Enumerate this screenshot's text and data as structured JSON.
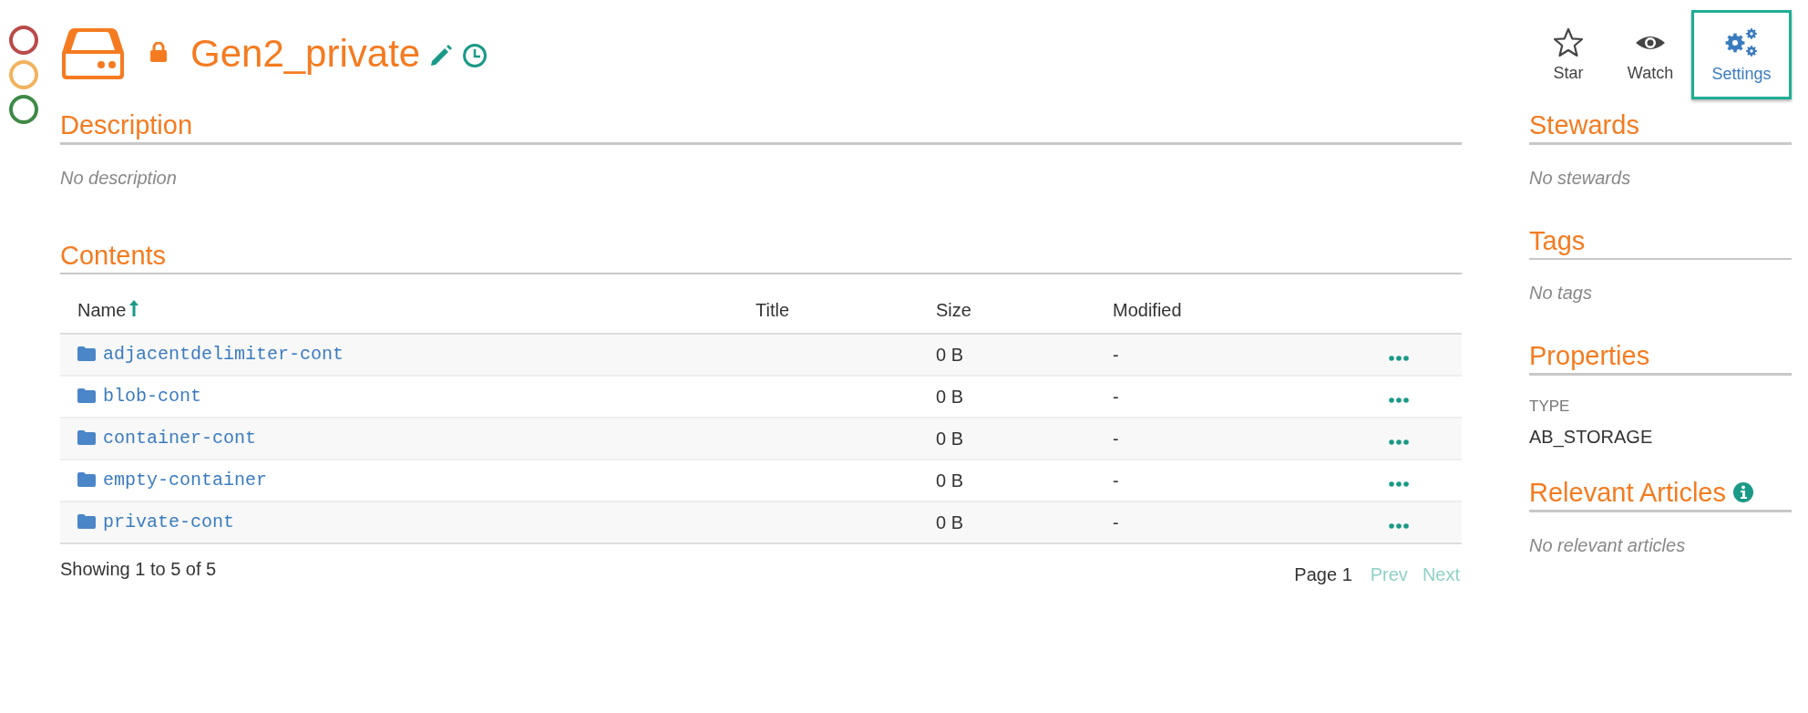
{
  "status_circles": [
    {
      "color": "#b94a48"
    },
    {
      "color": "#f0b35e"
    },
    {
      "color": "#3f8a46"
    }
  ],
  "header": {
    "title": "Gen2_private",
    "locked": true
  },
  "actions": [
    {
      "kind": "star",
      "label": "Star",
      "selected": false
    },
    {
      "kind": "watch",
      "label": "Watch",
      "selected": false
    },
    {
      "kind": "settings",
      "label": "Settings",
      "selected": true
    }
  ],
  "description": {
    "heading": "Description",
    "text": "No description"
  },
  "contents": {
    "heading": "Contents",
    "columns": [
      {
        "label": "Name",
        "sorted": true
      },
      {
        "label": "Title",
        "sorted": false
      },
      {
        "label": "Size",
        "sorted": false
      },
      {
        "label": "Modified",
        "sorted": false
      }
    ],
    "rows": [
      {
        "name": "adjacentdelimiter-cont",
        "size": "0 B",
        "modified": "-"
      },
      {
        "name": "blob-cont",
        "size": "0 B",
        "modified": "-"
      },
      {
        "name": "container-cont",
        "size": "0 B",
        "modified": "-"
      },
      {
        "name": "empty-container",
        "size": "0 B",
        "modified": "-"
      },
      {
        "name": "private-cont",
        "size": "0 B",
        "modified": "-"
      }
    ],
    "summary": "Showing 1 to 5 of 5",
    "pager": {
      "page": "Page 1",
      "prev": {
        "label": "Prev",
        "disabled": true
      },
      "next": {
        "label": "Next",
        "disabled": true
      }
    }
  },
  "sidebar": {
    "stewards": {
      "heading": "Stewards",
      "text": "No stewards"
    },
    "tags": {
      "heading": "Tags",
      "text": "No tags"
    },
    "properties": {
      "heading": "Properties",
      "items": [
        {
          "label": "TYPE",
          "value": "AB_STORAGE"
        }
      ]
    },
    "articles": {
      "heading": "Relevant Articles",
      "text": "No relevant articles"
    }
  }
}
